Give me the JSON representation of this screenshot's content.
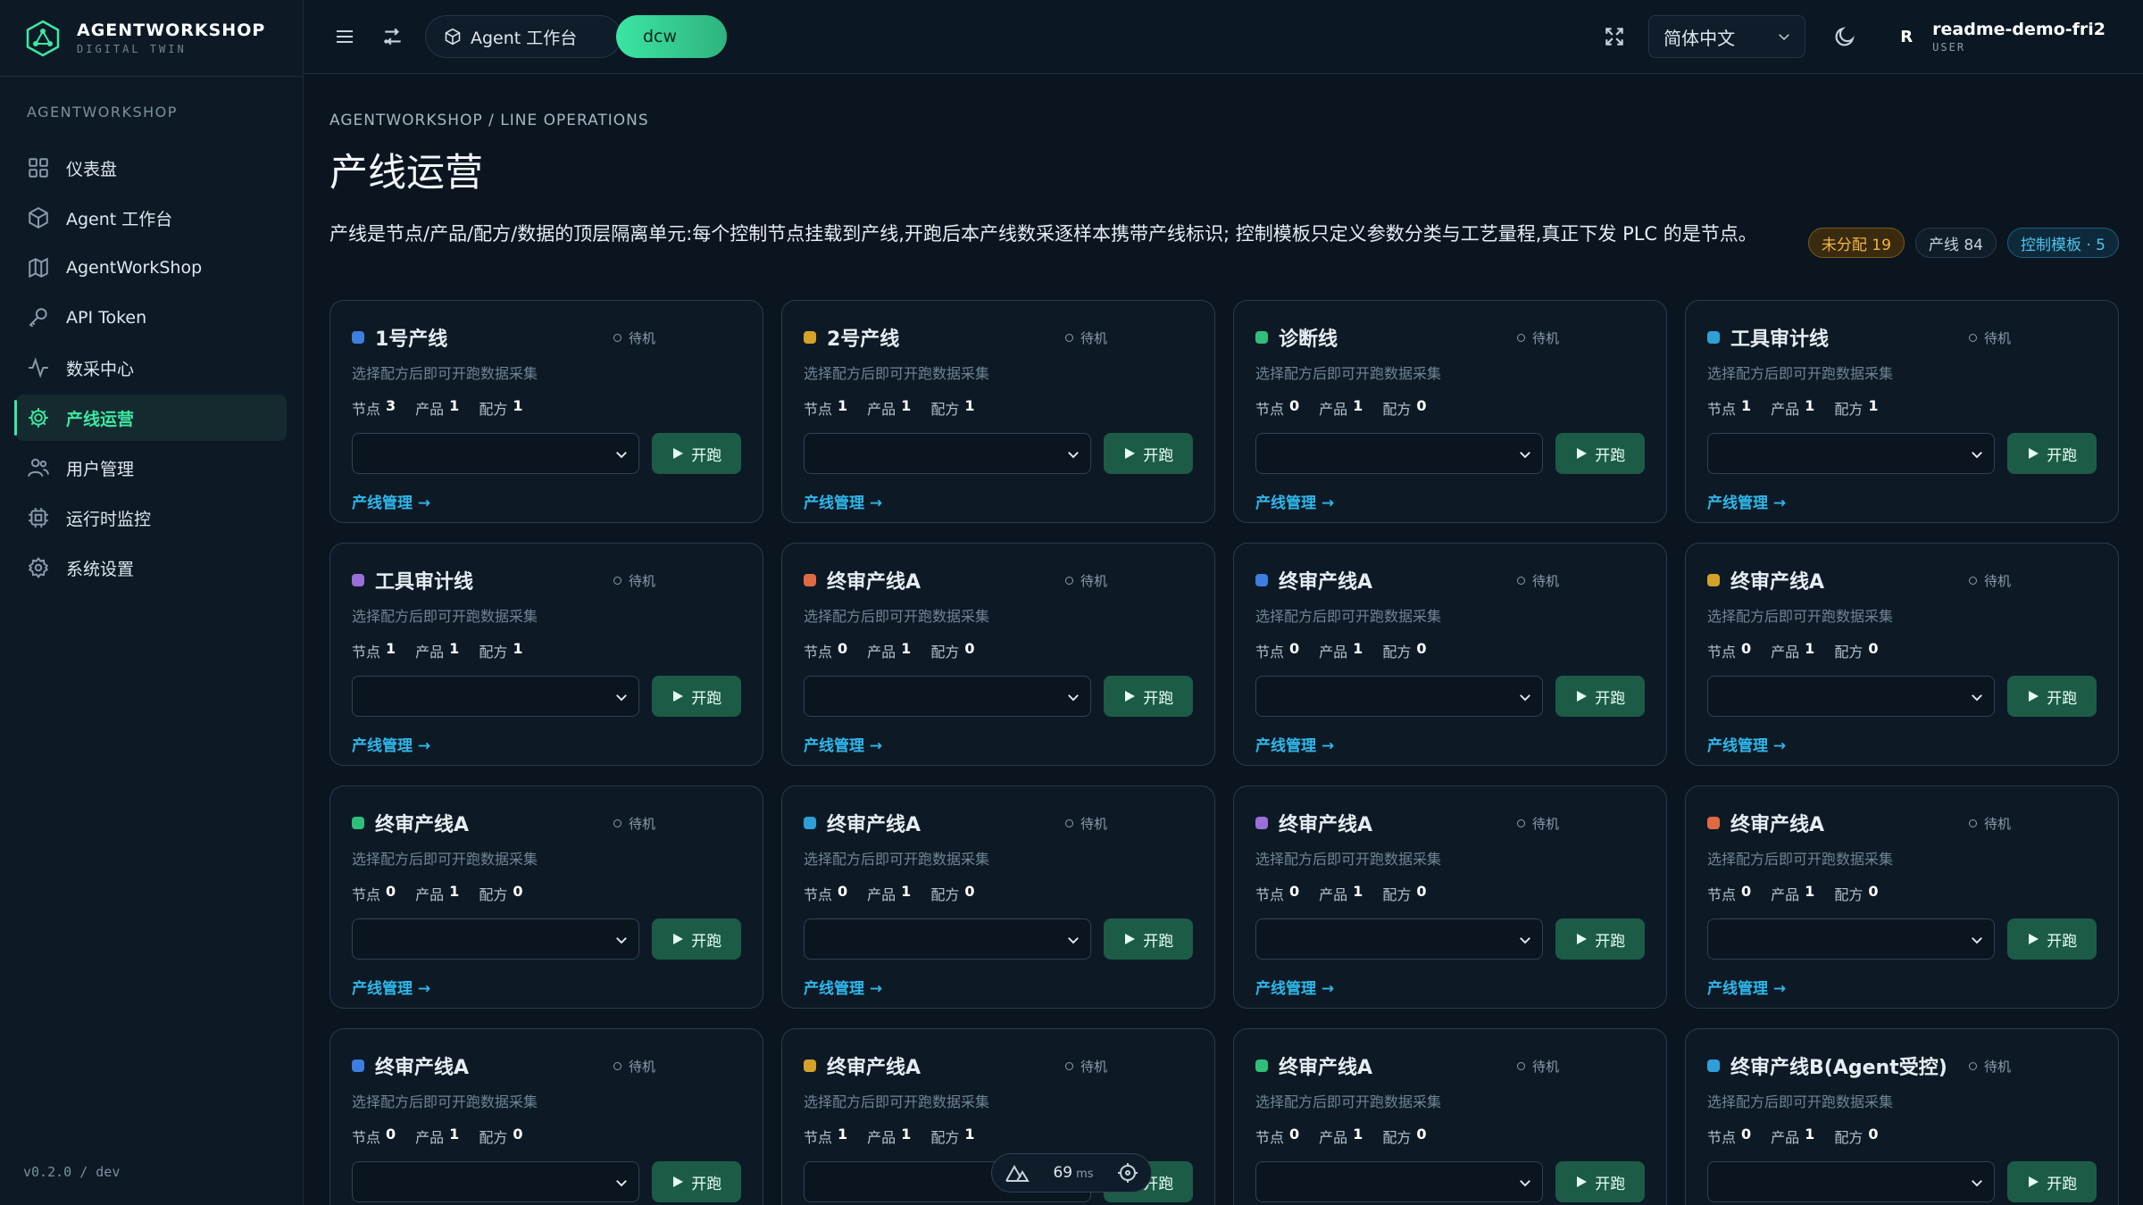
{
  "brand": {
    "name": "AGENTWORKSHOP",
    "sub": "DIGITAL TWIN"
  },
  "sidebar": {
    "section": "AGENTWORKSHOP",
    "items": [
      {
        "label": "仪表盘",
        "icon": "dashboard-icon"
      },
      {
        "label": "Agent 工作台",
        "icon": "cube-icon"
      },
      {
        "label": "AgentWorkShop",
        "icon": "map-icon"
      },
      {
        "label": "API Token",
        "icon": "key-icon"
      },
      {
        "label": "数采中心",
        "icon": "activity-icon"
      },
      {
        "label": "产线运营",
        "icon": "gear-icon",
        "active": true
      },
      {
        "label": "用户管理",
        "icon": "users-icon"
      },
      {
        "label": "运行时监控",
        "icon": "cpu-icon"
      },
      {
        "label": "系统设置",
        "icon": "settings-icon"
      }
    ],
    "version": "v0.2.0 / dev"
  },
  "topbar": {
    "agent_tab": "Agent 工作台",
    "dcw_tab": "dcw",
    "language": "简体中文",
    "user": {
      "initial": "R",
      "name": "readme-demo-fri2",
      "role": "USER"
    }
  },
  "page": {
    "breadcrumb": "AGENTWORKSHOP / LINE OPERATIONS",
    "title": "产线运营",
    "description": "产线是节点/产品/配方/数据的顶层隔离单元:每个控制节点挂载到产线,开跑后本产线数采逐样本携带产线标识; 控制模板只定义参数分类与工艺量程,真正下发 PLC 的是节点。",
    "badges": {
      "unassigned": "未分配 19",
      "lines": "产线 84",
      "control_templates": "控制模板 · 5"
    }
  },
  "card_common": {
    "status": "待机",
    "hint": "选择配方后即可开跑数据采集",
    "labels": {
      "nodes": "节点",
      "products": "产品",
      "recipes": "配方"
    },
    "run_label": "开跑",
    "manage_link": "产线管理 →"
  },
  "colors": {
    "accent": "#3de8a3",
    "link": "#2fb7ea",
    "run_bg": "#1c5c46"
  },
  "lines": [
    {
      "name": "1号产线",
      "color": "#3d7ee0",
      "nodes": "3",
      "products": "1",
      "recipes": "1"
    },
    {
      "name": "2号产线",
      "color": "#d4a22a",
      "nodes": "1",
      "products": "1",
      "recipes": "1"
    },
    {
      "name": "诊断线",
      "color": "#2fbf7a",
      "nodes": "0",
      "products": "1",
      "recipes": "0"
    },
    {
      "name": "工具审计线",
      "color": "#2f9fd8",
      "nodes": "1",
      "products": "1",
      "recipes": "1"
    },
    {
      "name": "工具审计线",
      "color": "#9a6fd8",
      "nodes": "1",
      "products": "1",
      "recipes": "1"
    },
    {
      "name": "终审产线A",
      "color": "#e06a44",
      "nodes": "0",
      "products": "1",
      "recipes": "0"
    },
    {
      "name": "终审产线A",
      "color": "#3d7ee0",
      "nodes": "0",
      "products": "1",
      "recipes": "0"
    },
    {
      "name": "终审产线A",
      "color": "#d4a22a",
      "nodes": "0",
      "products": "1",
      "recipes": "0"
    },
    {
      "name": "终审产线A",
      "color": "#2fbf7a",
      "nodes": "0",
      "products": "1",
      "recipes": "0"
    },
    {
      "name": "终审产线A",
      "color": "#2f9fd8",
      "nodes": "0",
      "products": "1",
      "recipes": "0"
    },
    {
      "name": "终审产线A",
      "color": "#9a6fd8",
      "nodes": "0",
      "products": "1",
      "recipes": "0"
    },
    {
      "name": "终审产线A",
      "color": "#e06a44",
      "nodes": "0",
      "products": "1",
      "recipes": "0"
    },
    {
      "name": "终审产线A",
      "color": "#3d7ee0",
      "nodes": "0",
      "products": "1",
      "recipes": "0"
    },
    {
      "name": "终审产线A",
      "color": "#d4a22a",
      "nodes": "1",
      "products": "1",
      "recipes": "1"
    },
    {
      "name": "终审产线A",
      "color": "#2fbf7a",
      "nodes": "0",
      "products": "1",
      "recipes": "0"
    },
    {
      "name": "终审产线B(Agent受控)",
      "color": "#2f9fd8",
      "nodes": "0",
      "products": "1",
      "recipes": "0"
    }
  ],
  "perf": {
    "value": "69",
    "unit": "ms"
  }
}
